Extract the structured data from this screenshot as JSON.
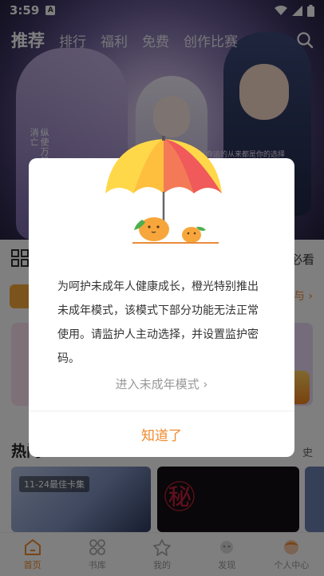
{
  "status_bar": {
    "time": "3:59",
    "notif_glyph": "A"
  },
  "banner": {
    "text_vertical": "纵使万般绝望，而爱永不消亡",
    "small_text": "这是命运的从来都是你的选择"
  },
  "top_nav": {
    "tabs": [
      {
        "label": "推荐",
        "active": true
      },
      {
        "label": "排行",
        "active": false
      },
      {
        "label": "福利",
        "active": false
      },
      {
        "label": "免费",
        "active": false
      },
      {
        "label": "创作比赛",
        "active": false
      }
    ]
  },
  "page": {
    "more_read": "必看",
    "row_link": "与 ›",
    "section_title": "热门",
    "section_right": "史",
    "card1_tag": "11-24最佳卡集"
  },
  "dialog": {
    "message": "为呵护未成年人健康成长，橙光特别推出未成年模式，该模式下部分功能无法正常使用。请监护人主动选择，并设置监护密码。",
    "youth_mode_link": "进入未成年模式",
    "youth_mode_chevron": "›",
    "ok_button": "知道了"
  },
  "bottom_nav": {
    "items": [
      {
        "label": "首页",
        "icon": "home-icon",
        "active": true
      },
      {
        "label": "书库",
        "icon": "grid-icon",
        "active": false
      },
      {
        "label": "我的",
        "icon": "star-icon",
        "active": false
      },
      {
        "label": "发现",
        "icon": "discover-icon",
        "active": false
      },
      {
        "label": "个人中心",
        "icon": "avatar-icon",
        "active": false
      }
    ]
  },
  "colors": {
    "accent": "#f08a2c",
    "umbrella_red": "#f05a5a",
    "umbrella_yellow": "#ffd84a",
    "orange_fruit": "#f7a63c"
  }
}
